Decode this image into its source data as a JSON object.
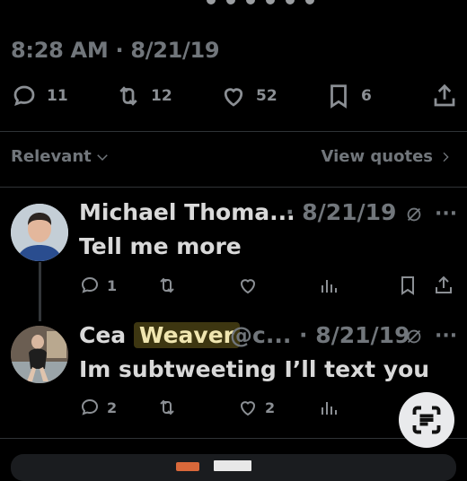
{
  "tweet": {
    "timestamp": "8:28 AM · 8/21/19",
    "stats": [
      {
        "icon": "reply-icon",
        "count": "11"
      },
      {
        "icon": "retweet-icon",
        "count": "12"
      },
      {
        "icon": "like-icon",
        "count": "52"
      },
      {
        "icon": "bookmark-icon",
        "count": "6"
      },
      {
        "icon": "share-icon",
        "count": ""
      }
    ]
  },
  "replies_bar": {
    "filter_label": "Relevant",
    "view_quotes_label": "View quotes"
  },
  "replies": [
    {
      "author": "Michael Thoma...",
      "meta": "· 8/21/19",
      "text": "Tell me more",
      "reply_count": "1",
      "retweet_count": "",
      "like_count": ""
    },
    {
      "author_prefix": "Cea",
      "author_highlight": "Weaver",
      "handle": "@c...",
      "meta": "· 8/21/19",
      "text": "Im subtweeting I’ll text you",
      "reply_count": "2",
      "retweet_count": "",
      "like_count": "2"
    }
  ]
}
